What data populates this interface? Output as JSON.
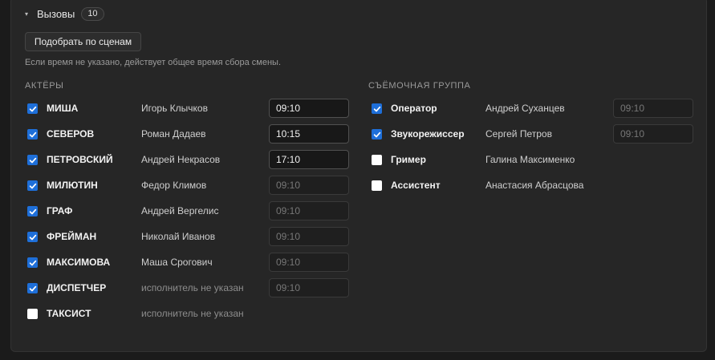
{
  "section": {
    "title": "Вызовы",
    "count": "10"
  },
  "match_button": "Подобрать по сценам",
  "hint": "Если время не указано, действует общее время сбора смены.",
  "actors": {
    "title": "АКТЁРЫ",
    "rows": [
      {
        "role": "МИША",
        "person": "Игорь Клычков",
        "checked": true,
        "time": "09:10",
        "time_set": true
      },
      {
        "role": "СЕВЕРОВ",
        "person": "Роман Дадаев",
        "checked": true,
        "time": "10:15",
        "time_set": true
      },
      {
        "role": "ПЕТРОВСКИЙ",
        "person": "Андрей Некрасов",
        "checked": true,
        "time": "17:10",
        "time_set": true
      },
      {
        "role": "МИЛЮТИН",
        "person": "Федор Климов",
        "checked": true,
        "time": "09:10",
        "time_set": false
      },
      {
        "role": "ГРАФ",
        "person": "Андрей Вергелис",
        "checked": true,
        "time": "09:10",
        "time_set": false
      },
      {
        "role": "ФРЕЙМАН",
        "person": "Николай Иванов",
        "checked": true,
        "time": "09:10",
        "time_set": false
      },
      {
        "role": "МАКСИМОВА",
        "person": "Маша Срогович",
        "checked": true,
        "time": "09:10",
        "time_set": false
      },
      {
        "role": "ДИСПЕТЧЕР",
        "person": "исполнитель не указан",
        "checked": true,
        "time": "09:10",
        "time_set": false,
        "unassigned": true
      },
      {
        "role": "ТАКСИСТ",
        "person": "исполнитель не указан",
        "checked": false,
        "time": "",
        "time_set": false,
        "unassigned": true
      }
    ]
  },
  "crew": {
    "title": "СЪЁМОЧНАЯ ГРУППА",
    "rows": [
      {
        "role": "Оператор",
        "person": "Андрей Суханцев",
        "checked": true,
        "time": "09:10",
        "time_set": false
      },
      {
        "role": "Звукорежиссер",
        "person": "Сергей Петров",
        "checked": true,
        "time": "09:10",
        "time_set": false
      },
      {
        "role": "Гример",
        "person": "Галина Максименко",
        "checked": false,
        "time": "",
        "time_set": false
      },
      {
        "role": "Ассистент",
        "person": "Анастасия Абрасцова",
        "checked": false,
        "time": "",
        "time_set": false
      }
    ]
  },
  "colors": {
    "accent": "#1e6fd9",
    "panel": "#262626",
    "background": "#1b1b1b"
  }
}
